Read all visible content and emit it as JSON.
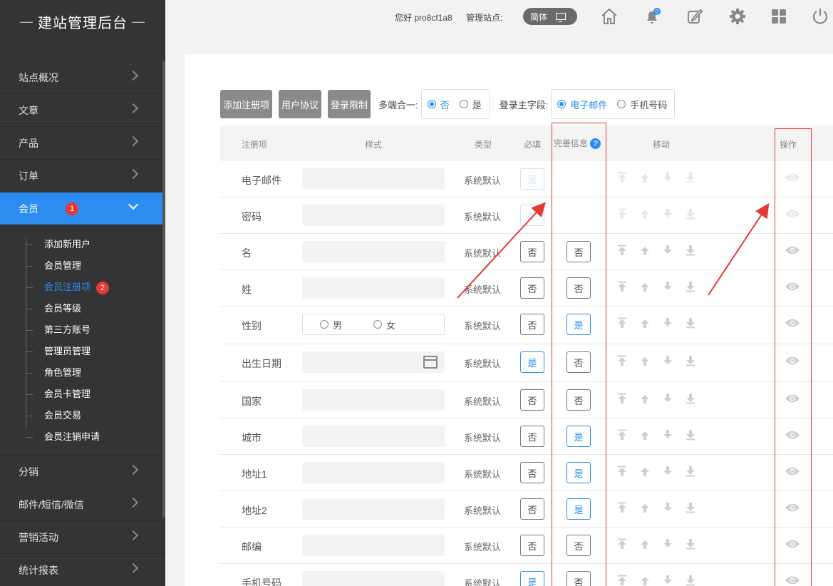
{
  "app": {
    "title": "建站管理后台"
  },
  "header": {
    "greeting": "您好 pro8cf1a8",
    "site_label": "管理站点:",
    "lang": "简体",
    "notification_count": "0"
  },
  "sidebar": {
    "items": [
      {
        "label": "站点概况"
      },
      {
        "label": "文章"
      },
      {
        "label": "产品"
      },
      {
        "label": "订单"
      },
      {
        "label": "会员",
        "badge": "1"
      },
      {
        "label": "分销"
      },
      {
        "label": "邮件/短信/微信"
      },
      {
        "label": "营销活动"
      },
      {
        "label": "统计报表"
      }
    ],
    "submenu": [
      {
        "label": "添加新用户"
      },
      {
        "label": "会员管理"
      },
      {
        "label": "会员注册项",
        "badge": "2"
      },
      {
        "label": "会员等级"
      },
      {
        "label": "第三方账号"
      },
      {
        "label": "管理员管理"
      },
      {
        "label": "角色管理"
      },
      {
        "label": "会员卡管理"
      },
      {
        "label": "会员交易"
      },
      {
        "label": "会员注销申请"
      }
    ]
  },
  "toolbar": {
    "add_label": "添加注册项",
    "agreement_label": "用户协议",
    "login_limit_label": "登录限制",
    "multi_label": "多端合一:",
    "multi_no": "否",
    "multi_yes": "是",
    "login_field_label": "登录主字段:",
    "login_email": "电子邮件",
    "login_phone": "手机号码"
  },
  "table": {
    "headers": {
      "name": "注册项",
      "style": "样式",
      "type": "类型",
      "required": "必填",
      "info": "完善信息",
      "move": "移动",
      "ops": "操作"
    },
    "gender_male": "男",
    "gender_female": "女",
    "rows": [
      {
        "name": "电子邮件",
        "type": "系统默认",
        "required": "是",
        "info": ""
      },
      {
        "name": "密码",
        "type": "系统默认",
        "required": "是",
        "info": ""
      },
      {
        "name": "名",
        "type": "系统默认",
        "required": "否",
        "info": "否"
      },
      {
        "name": "姓",
        "type": "系统默认",
        "required": "否",
        "info": "否"
      },
      {
        "name": "性别",
        "type": "系统默认",
        "required": "否",
        "info": "是"
      },
      {
        "name": "出生日期",
        "type": "系统默认",
        "required": "是",
        "info": "否"
      },
      {
        "name": "国家",
        "type": "系统默认",
        "required": "否",
        "info": "否"
      },
      {
        "name": "城市",
        "type": "系统默认",
        "required": "否",
        "info": "是"
      },
      {
        "name": "地址1",
        "type": "系统默认",
        "required": "否",
        "info": "是"
      },
      {
        "name": "地址2",
        "type": "系统默认",
        "required": "否",
        "info": "是"
      },
      {
        "name": "邮编",
        "type": "系统默认",
        "required": "否",
        "info": "否"
      },
      {
        "name": "手机号码",
        "type": "系统默认",
        "required": "是",
        "info": "否"
      }
    ]
  },
  "colors": {
    "accent": "#2d8cf0",
    "sidebar_bg": "#333435",
    "annotation": "#e53935"
  }
}
